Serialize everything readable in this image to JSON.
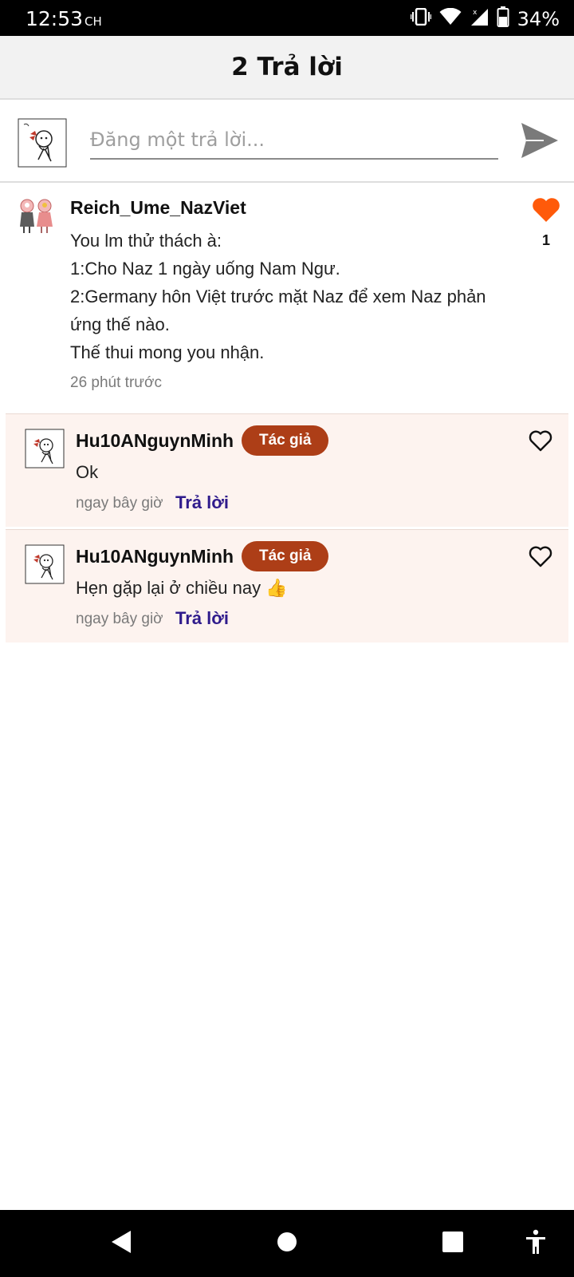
{
  "status_bar": {
    "time": "12:53",
    "time_suffix": "CH",
    "battery": "34%",
    "icons": [
      "vibrate-icon",
      "wifi-icon",
      "signal-icon",
      "battery-icon"
    ]
  },
  "header": {
    "title": "2 Trả lời"
  },
  "composer": {
    "placeholder": "Đăng một trả lời...",
    "send_icon": "send-icon"
  },
  "comment": {
    "author": "Reich_Ume_NazViet",
    "lines": [
      "You lm thử thách à:",
      "1:Cho Naz 1 ngày uống Nam Ngư.",
      "2:Germany hôn Việt trước mặt Naz để xem Naz phản",
      "ứng thế nào.",
      "Thế thui mong you nhận."
    ],
    "time": "26 phút trước",
    "likes": "1",
    "liked": true,
    "like_color": "#ff5a0a"
  },
  "replies": [
    {
      "author": "Hu10ANguynMinh",
      "badge": "Tác giả",
      "text": "Ok",
      "time": "ngay bây giờ",
      "reply_label": "Trả lời"
    },
    {
      "author": "Hu10ANguynMinh",
      "badge": "Tác giả",
      "text": "Hẹn gặp lại ở chiều nay 👍",
      "time": "ngay bây giờ",
      "reply_label": "Trả lời"
    }
  ],
  "colors": {
    "badge": "#ad3e17",
    "reply_link": "#2f1b8c",
    "reply_bg": "#fdf3ef"
  },
  "nav_bar": {
    "icons": [
      "back-icon",
      "home-icon",
      "recents-icon",
      "accessibility-icon"
    ]
  }
}
